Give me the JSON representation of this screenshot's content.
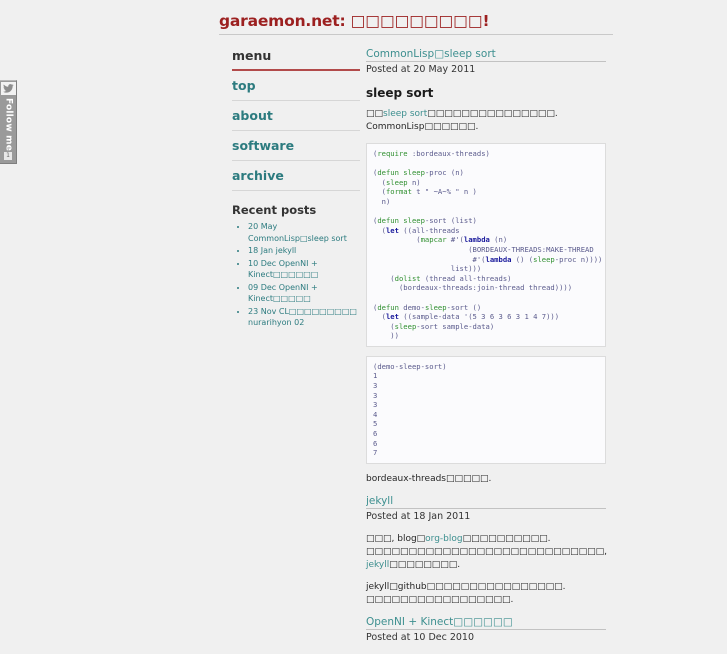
{
  "site": {
    "title_prefix": "garaemon.net:",
    "title_jp": "□□□□□□□□□!",
    "title_color": "#9c2020"
  },
  "follow_widget": {
    "label": "Follow me",
    "bird_icon": "twitter-bird-icon",
    "badge": "1"
  },
  "sidebar": {
    "menu_heading": "menu",
    "items": [
      {
        "label": "top"
      },
      {
        "label": "about"
      },
      {
        "label": "software"
      },
      {
        "label": "archive"
      }
    ],
    "recent_heading": "Recent posts",
    "recent_posts": [
      {
        "date": "20 May",
        "title": "CommonLisp□sleep sort"
      },
      {
        "date": "18 Jan",
        "title": "jekyll"
      },
      {
        "date": "10 Dec",
        "title": "OpenNI + Kinect□□□□□□"
      },
      {
        "date": "09 Dec",
        "title": "OpenNI + Kinect□□□□□"
      },
      {
        "date": "23 Nov",
        "title": "CL□□□□□□□□□ nurarihyon 02"
      }
    ]
  },
  "posts": [
    {
      "title": "CommonLisp□sleep sort",
      "meta": "Posted at 20 May 2011",
      "heading": "sleep sort",
      "intro_before": "□□",
      "intro_link": "sleep sort",
      "intro_after": "□□□□□□□□□□□□□□□. CommonLisp□□□□□□.",
      "code": "(require :bordeaux-threads)\n\n(defun sleep-proc (n)\n  (sleep n)\n  (format t \" ~A~% \" n )\n  n)\n\n(defun sleep-sort (list)\n  (let ((all-threads\n          (mapcar #'(lambda (n)\n                      (BORDEAUX-THREADS:MAKE-THREAD\n                       #'(lambda () (sleep-proc n))))\n                  list)))\n    (dolist (thread all-threads)\n      (bordeaux-threads:join-thread thread))))\n\n(defun demo-sleep-sort ()\n  (let ((sample-data '(5 3 6 3 6 3 1 4 7)))\n    (sleep-sort sample-data)\n    ))",
      "output": "(demo-sleep-sort)\n1\n3\n3\n3\n4\n5\n6\n6\n7",
      "closing": "bordeaux-threads□□□□□."
    },
    {
      "title": "jekyll",
      "meta": "Posted at 18 Jan 2011",
      "para1_a": "□□□, blog□",
      "para1_link1": "org-blog",
      "para1_b": "□□□□□□□□□□. □□□□□□□□□□□□□□□□□□□□□□□□□□□□, ",
      "para1_link2": "jekyll",
      "para1_c": "□□□□□□□□.",
      "para2": "jekyll□github□□□□□□□□□□□□□□□□. □□□□□□□□□□□□□□□□□."
    },
    {
      "title": "OpenNI + Kinect□□□□□□",
      "meta": "Posted at 10 Dec 2010"
    }
  ],
  "colors": {
    "link_teal": "#3d8f8f",
    "menu_teal": "#2c7b7f",
    "accent_red": "#b24a4a",
    "page_bg": "#f0f0f0",
    "code_bg": "#fbfbfd"
  }
}
